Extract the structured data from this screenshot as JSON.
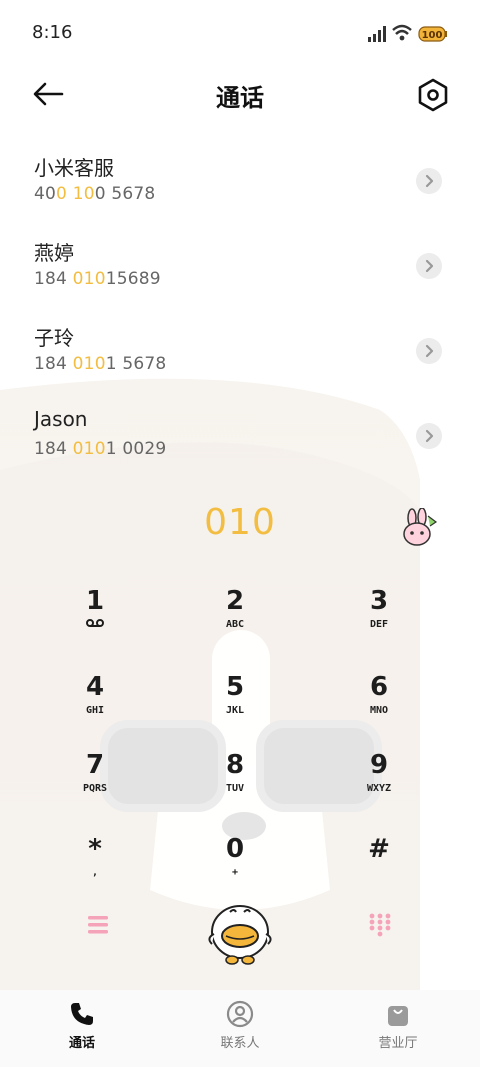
{
  "status_bar": {
    "time": "8:16",
    "battery": "100"
  },
  "header": {
    "title": "通话"
  },
  "contacts": [
    {
      "name": "小米客服",
      "num_parts": [
        "40",
        "0",
        " ",
        "10",
        "0 5678"
      ]
    },
    {
      "name": "燕婷",
      "num_parts": [
        "184 ",
        "010",
        "",
        "",
        "15689"
      ]
    },
    {
      "name": "子玲",
      "num_parts": [
        "184 ",
        "010",
        "",
        "",
        "1 5678"
      ]
    },
    {
      "name": "Jason",
      "num_parts": [
        "184 ",
        "010",
        "",
        "",
        "1 0029"
      ]
    }
  ],
  "dialed_number": "010",
  "keypad": [
    {
      "digit": "1",
      "letters": ""
    },
    {
      "digit": "2",
      "letters": "ABC"
    },
    {
      "digit": "3",
      "letters": "DEF"
    },
    {
      "digit": "4",
      "letters": "GHI"
    },
    {
      "digit": "5",
      "letters": "JKL"
    },
    {
      "digit": "6",
      "letters": "MNO"
    },
    {
      "digit": "7",
      "letters": "PQRS"
    },
    {
      "digit": "8",
      "letters": "TUV"
    },
    {
      "digit": "9",
      "letters": "WXYZ"
    },
    {
      "digit": "*",
      "letters": ","
    },
    {
      "digit": "0",
      "letters": "+"
    },
    {
      "digit": "#",
      "letters": ""
    }
  ],
  "nav": [
    {
      "label": "通话",
      "icon": "phone-icon",
      "active": true
    },
    {
      "label": "联系人",
      "icon": "contacts-icon",
      "active": false
    },
    {
      "label": "营业厅",
      "icon": "store-bag-icon",
      "active": false
    }
  ],
  "colors": {
    "accent": "#f2bd40",
    "menu_pink": "#f5a3b8",
    "text": "#222222"
  }
}
